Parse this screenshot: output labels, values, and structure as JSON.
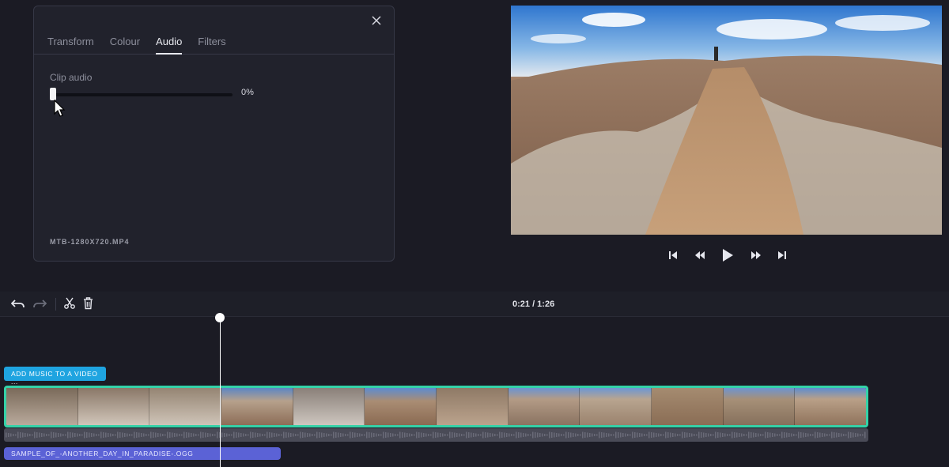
{
  "panel": {
    "tabs": [
      {
        "label": "Transform",
        "active": false
      },
      {
        "label": "Colour",
        "active": false
      },
      {
        "label": "Audio",
        "active": true
      },
      {
        "label": "Filters",
        "active": false
      }
    ],
    "close_icon": "close-icon",
    "clip_audio_label": "Clip audio",
    "clip_audio_value": "0%",
    "clip_audio_level": 0,
    "clip_filename": "MTB-1280X720.MP4"
  },
  "player": {
    "icons": [
      "skip-back-icon",
      "rewind-icon",
      "play-icon",
      "fast-forward-icon",
      "skip-forward-icon"
    ]
  },
  "timeline": {
    "toolbar_icons": [
      "undo-icon",
      "redo-icon",
      "scissors-icon",
      "trash-icon"
    ],
    "time_readout": "0:21 / 1:26",
    "add_music_label": "ADD MUSIC TO A VIDEO ...",
    "music_clip_label": "SAMPLE_OF_-ANOTHER_DAY_IN_PARADISE-.OGG"
  },
  "colors": {
    "accent_clip_border": "#34d2a8",
    "add_music_button": "#1fa4e0",
    "music_clip": "#5b62d6",
    "background": "#1b1b24"
  }
}
